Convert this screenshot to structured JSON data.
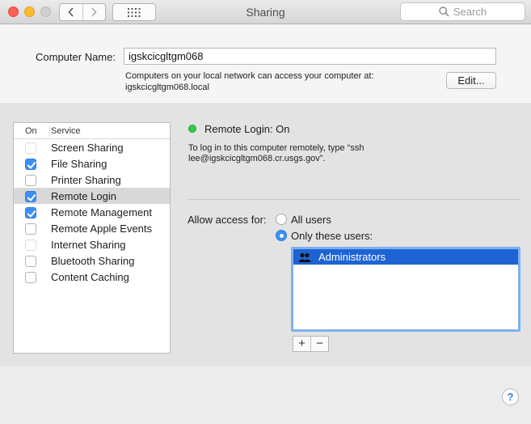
{
  "window": {
    "title": "Sharing"
  },
  "toolbar": {
    "search_placeholder": "Search"
  },
  "computer_name": {
    "label": "Computer Name:",
    "value": "igskcicgltgm068",
    "description_line1": "Computers on your local network can access your computer at:",
    "description_line2": "igskcicgltgm068.local",
    "edit_label": "Edit..."
  },
  "services": {
    "header_on": "On",
    "header_service": "Service",
    "items": [
      {
        "label": "Screen Sharing",
        "checked": false,
        "enabled": false,
        "selected": false
      },
      {
        "label": "File Sharing",
        "checked": true,
        "enabled": true,
        "selected": false
      },
      {
        "label": "Printer Sharing",
        "checked": false,
        "enabled": true,
        "selected": false
      },
      {
        "label": "Remote Login",
        "checked": true,
        "enabled": true,
        "selected": true
      },
      {
        "label": "Remote Management",
        "checked": true,
        "enabled": true,
        "selected": false
      },
      {
        "label": "Remote Apple Events",
        "checked": false,
        "enabled": true,
        "selected": false
      },
      {
        "label": "Internet Sharing",
        "checked": false,
        "enabled": false,
        "selected": false
      },
      {
        "label": "Bluetooth Sharing",
        "checked": false,
        "enabled": true,
        "selected": false
      },
      {
        "label": "Content Caching",
        "checked": false,
        "enabled": true,
        "selected": false
      }
    ]
  },
  "detail": {
    "status": "Remote Login: On",
    "status_color": "#2ecc42",
    "desc_line1": "To log in to this computer remotely, type “ssh",
    "desc_line2": "lee@igskcicgltgm068.cr.usgs.gov”.",
    "allow_label": "Allow access for:",
    "option_all": "All users",
    "option_only": "Only these users:",
    "selected_option": "only",
    "users": [
      {
        "name": "Administrators",
        "icon": "group-icon"
      }
    ],
    "add_label": "+",
    "remove_label": "−"
  },
  "help": {
    "label": "?"
  },
  "colors": {
    "accent": "#3c8ff5",
    "selection": "#1e63d4"
  }
}
